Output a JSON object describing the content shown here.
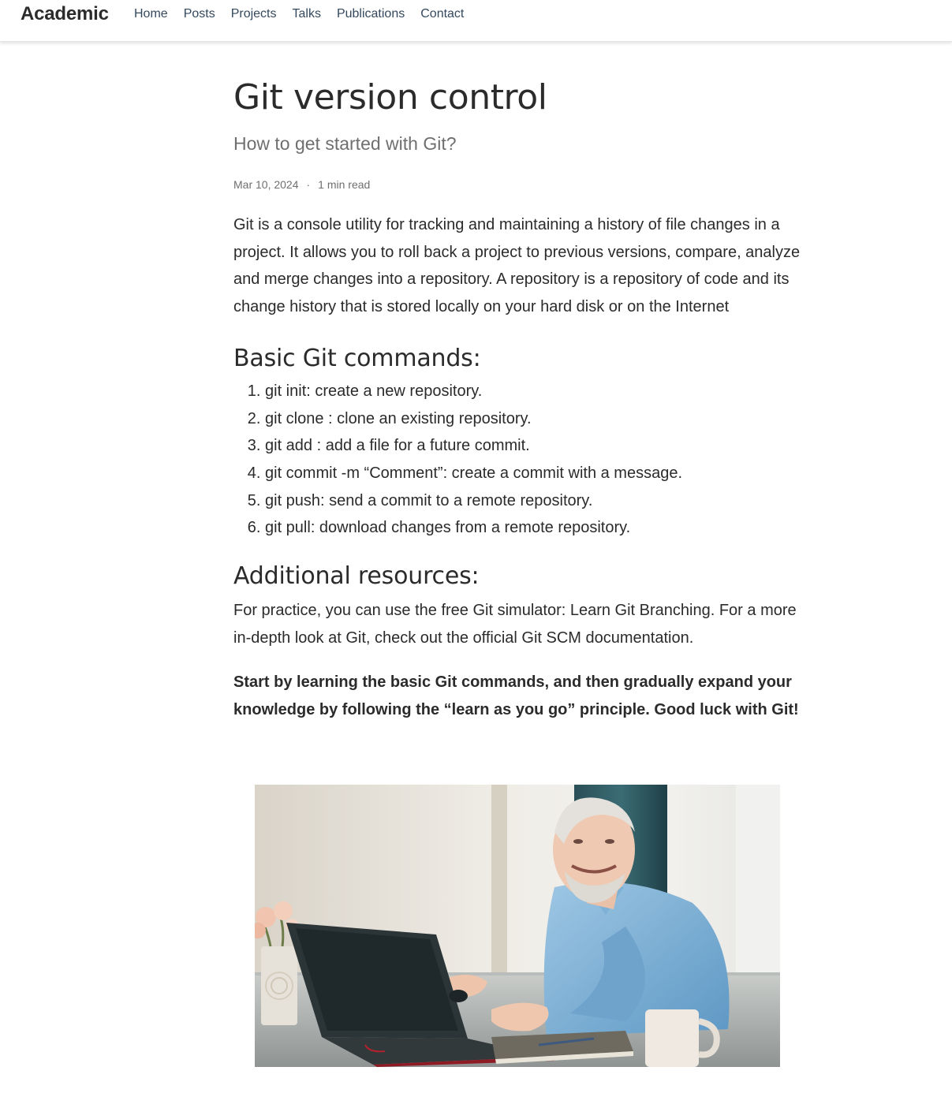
{
  "navbar": {
    "brand": "Academic",
    "links": [
      "Home",
      "Posts",
      "Projects",
      "Talks",
      "Publications",
      "Contact"
    ]
  },
  "article": {
    "title": "Git version control",
    "subtitle": "How to get started with Git?",
    "date": "Mar 10, 2024",
    "separator": "·",
    "read_time": "1 min read",
    "intro": "Git is a console utility for tracking and maintaining a history of file changes in a project. It allows you to roll back a project to previous versions, compare, analyze and merge changes into a repository. A repository is a repository of code and its change history that is stored locally on your hard disk or on the Internet",
    "commands_heading": "Basic Git commands:",
    "commands": [
      "git init: create a new repository.",
      "git clone : clone an existing repository.",
      "git add : add a file for a future commit.",
      "git commit -m “Comment”: create a commit with a message.",
      "git push: send a commit to a remote repository.",
      "git pull: download changes from a remote repository."
    ],
    "resources_heading": "Additional resources:",
    "resources_text": "For practice, you can use the free Git simulator: Learn Git Branching. For a more in-depth look at Git, check out the official Git SCM documentation.",
    "closing_text": "Start by learning the basic Git commands, and then gradually expand your knowledge by following the “learn as you go” principle. Good luck with Git!"
  }
}
